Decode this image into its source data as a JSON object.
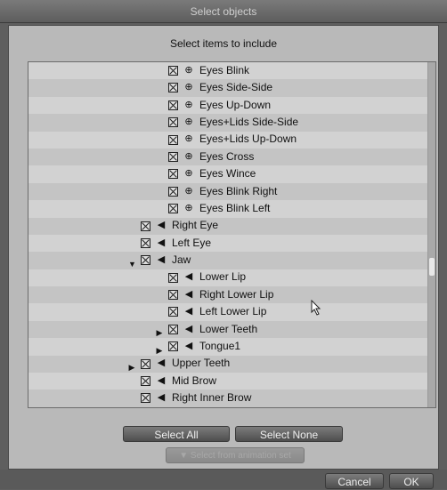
{
  "window": {
    "title": "Select objects"
  },
  "header": {
    "subtitle": "Select items to include"
  },
  "items": [
    {
      "label": "Eyes Blink",
      "type": "morph",
      "indent": 3,
      "expander": ""
    },
    {
      "label": "Eyes Side-Side",
      "type": "morph",
      "indent": 3,
      "expander": ""
    },
    {
      "label": "Eyes Up-Down",
      "type": "morph",
      "indent": 3,
      "expander": ""
    },
    {
      "label": "Eyes+Lids Side-Side",
      "type": "morph",
      "indent": 3,
      "expander": ""
    },
    {
      "label": "Eyes+Lids Up-Down",
      "type": "morph",
      "indent": 3,
      "expander": ""
    },
    {
      "label": "Eyes Cross",
      "type": "morph",
      "indent": 3,
      "expander": ""
    },
    {
      "label": "Eyes Wince",
      "type": "morph",
      "indent": 3,
      "expander": ""
    },
    {
      "label": "Eyes Blink Right",
      "type": "morph",
      "indent": 3,
      "expander": ""
    },
    {
      "label": "Eyes Blink Left",
      "type": "morph",
      "indent": 3,
      "expander": ""
    },
    {
      "label": "Right Eye",
      "type": "bone",
      "indent": 2,
      "expander": ""
    },
    {
      "label": "Left Eye",
      "type": "bone",
      "indent": 2,
      "expander": ""
    },
    {
      "label": "Jaw",
      "type": "bone",
      "indent": 2,
      "expander": "▼"
    },
    {
      "label": "Lower Lip",
      "type": "bone",
      "indent": 3,
      "expander": ""
    },
    {
      "label": "Right Lower Lip",
      "type": "bone",
      "indent": 3,
      "expander": ""
    },
    {
      "label": "Left Lower Lip",
      "type": "bone",
      "indent": 3,
      "expander": ""
    },
    {
      "label": "Lower Teeth",
      "type": "bone",
      "indent": 3,
      "expander": "▶"
    },
    {
      "label": "Tongue1",
      "type": "bone",
      "indent": 3,
      "expander": "▶"
    },
    {
      "label": "Upper Teeth",
      "type": "bone",
      "indent": 2,
      "expander": "▶"
    },
    {
      "label": "Mid Brow",
      "type": "bone",
      "indent": 2,
      "expander": ""
    },
    {
      "label": "Right Inner Brow",
      "type": "bone",
      "indent": 2,
      "expander": ""
    }
  ],
  "buttons": {
    "select_all": "Select All",
    "select_none": "Select None",
    "select_from_anim": "Select from animation set",
    "cancel": "Cancel",
    "ok": "OK"
  }
}
